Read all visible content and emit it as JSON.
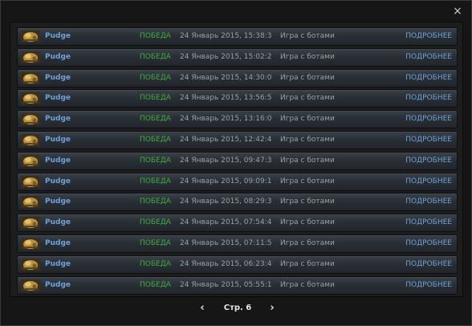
{
  "window": {
    "close_glyph": "×"
  },
  "matches": [
    {
      "hero": "Pudge",
      "result": "ПОБЕДА",
      "date": "24 Январь 2015, 15:38:3",
      "mode": "Игра с ботами",
      "details": "ПОДРОБНЕЕ"
    },
    {
      "hero": "Pudge",
      "result": "ПОБЕДА",
      "date": "24 Январь 2015, 15:02:2",
      "mode": "Игра с ботами",
      "details": "ПОДРОБНЕЕ"
    },
    {
      "hero": "Pudge",
      "result": "ПОБЕДА",
      "date": "24 Январь 2015, 14:30:0",
      "mode": "Игра с ботами",
      "details": "ПОДРОБНЕЕ"
    },
    {
      "hero": "Pudge",
      "result": "ПОБЕДА",
      "date": "24 Январь 2015, 13:56:5",
      "mode": "Игра с ботами",
      "details": "ПОДРОБНЕЕ"
    },
    {
      "hero": "Pudge",
      "result": "ПОБЕДА",
      "date": "24 Январь 2015, 13:16:0",
      "mode": "Игра с ботами",
      "details": "ПОДРОБНЕЕ"
    },
    {
      "hero": "Pudge",
      "result": "ПОБЕДА",
      "date": "24 Январь 2015, 12:42:4",
      "mode": "Игра с ботами",
      "details": "ПОДРОБНЕЕ"
    },
    {
      "hero": "Pudge",
      "result": "ПОБЕДА",
      "date": "24 Январь 2015, 09:47:3",
      "mode": "Игра с ботами",
      "details": "ПОДРОБНЕЕ"
    },
    {
      "hero": "Pudge",
      "result": "ПОБЕДА",
      "date": "24 Январь 2015, 09:09:1",
      "mode": "Игра с ботами",
      "details": "ПОДРОБНЕЕ"
    },
    {
      "hero": "Pudge",
      "result": "ПОБЕДА",
      "date": "24 Январь 2015, 08:29:3",
      "mode": "Игра с ботами",
      "details": "ПОДРОБНЕЕ"
    },
    {
      "hero": "Pudge",
      "result": "ПОБЕДА",
      "date": "24 Январь 2015, 07:54:4",
      "mode": "Игра с ботами",
      "details": "ПОДРОБНЕЕ"
    },
    {
      "hero": "Pudge",
      "result": "ПОБЕДА",
      "date": "24 Январь 2015, 07:11:5",
      "mode": "Игра с ботами",
      "details": "ПОДРОБНЕЕ"
    },
    {
      "hero": "Pudge",
      "result": "ПОБЕДА",
      "date": "24 Январь 2015, 06:23:4",
      "mode": "Игра с ботами",
      "details": "ПОДРОБНЕЕ"
    },
    {
      "hero": "Pudge",
      "result": "ПОБЕДА",
      "date": "24 Январь 2015, 05:55:1",
      "mode": "Игра с ботами",
      "details": "ПОДРОБНЕЕ"
    }
  ],
  "hero_icon": "pudge-hero-icon",
  "pagination": {
    "prev": "‹",
    "label": "Стр. 6",
    "next": "›"
  },
  "colors": {
    "hero_name": "#6fa2d8",
    "victory": "#3fae3f",
    "details_link": "#6fa2d8",
    "row_top": "#3a4049",
    "row_bottom": "#22262c"
  }
}
